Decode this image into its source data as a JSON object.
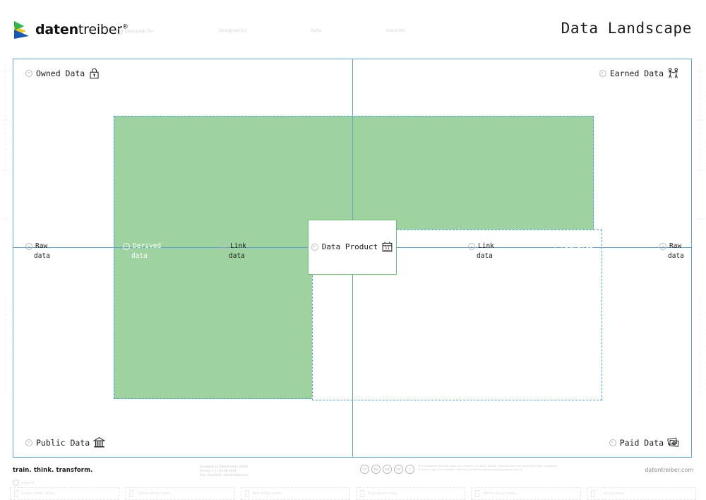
{
  "header": {
    "brand_name_bold": "daten",
    "brand_name_light": "treiber",
    "brand_sup": "®",
    "title": "Data Landscape",
    "meta_fields": [
      {
        "label": "Designed for",
        "has_bullet": true
      },
      {
        "label": "Designed by",
        "has_bullet": false
      },
      {
        "label": "Date",
        "has_bullet": false
      },
      {
        "label": "Iteration",
        "has_bullet": false
      }
    ]
  },
  "canvas": {
    "corners": [
      {
        "id": "owned-data",
        "label": "Owned Data",
        "icon": "lock-icon"
      },
      {
        "id": "earned-data",
        "label": "Earned Data",
        "icon": "handshake-people-icon"
      },
      {
        "id": "public-data",
        "label": "Public Data",
        "icon": "bank-building-icon"
      },
      {
        "id": "paid-data",
        "label": "Paid Data",
        "icon": "money-cash-icon"
      }
    ],
    "axis_labels": [
      {
        "id": "raw-left",
        "line1": "Raw",
        "line2": "data",
        "on_green": false
      },
      {
        "id": "derived-left",
        "line1": "Derived",
        "line2": "data",
        "on_green": true
      },
      {
        "id": "link-left",
        "line1": "Link",
        "line2": "data",
        "on_green": false
      },
      {
        "id": "link-right",
        "line1": "Link",
        "line2": "data",
        "on_green": false
      },
      {
        "id": "derived-right",
        "line1": "Derived",
        "line2": "data",
        "on_green": true
      },
      {
        "id": "raw-right",
        "line1": "Raw",
        "line2": "data",
        "on_green": false
      }
    ],
    "data_product": {
      "label": "Data Product",
      "icon": "calendar-icon",
      "calendar_day": "11"
    },
    "colors": {
      "green_fill": "#9ed3a0",
      "axis_blue": "#5ba7dd",
      "dashed_blue": "#4da3e0",
      "box_green": "#6cbf73"
    }
  },
  "footer": {
    "tagline": "train. think. transform.",
    "designer_lines": [
      "Designed by Datentreiber GmbH",
      "Version 1.1 | 03.06.2019",
      "Free download: datentreiber.com"
    ],
    "license_badges": [
      "cc",
      "by",
      "sa",
      "nc",
      "i"
    ],
    "license_text_lines": [
      "This material is licensed under the Creative Commons license 'Sharing under the same Terms and Conditions'.",
      "To view a copy of this license, visit http://creativecommons.org/licenses/by-sa/4.0/"
    ],
    "site": "datentreiber.com",
    "legend_title": "Legend",
    "legend_items": [
      "Green sticky notes",
      "Yellow sticky notes",
      "Red sticky notes",
      "Blue sticky notes",
      "White sticky notes",
      "... sticky notes"
    ]
  }
}
